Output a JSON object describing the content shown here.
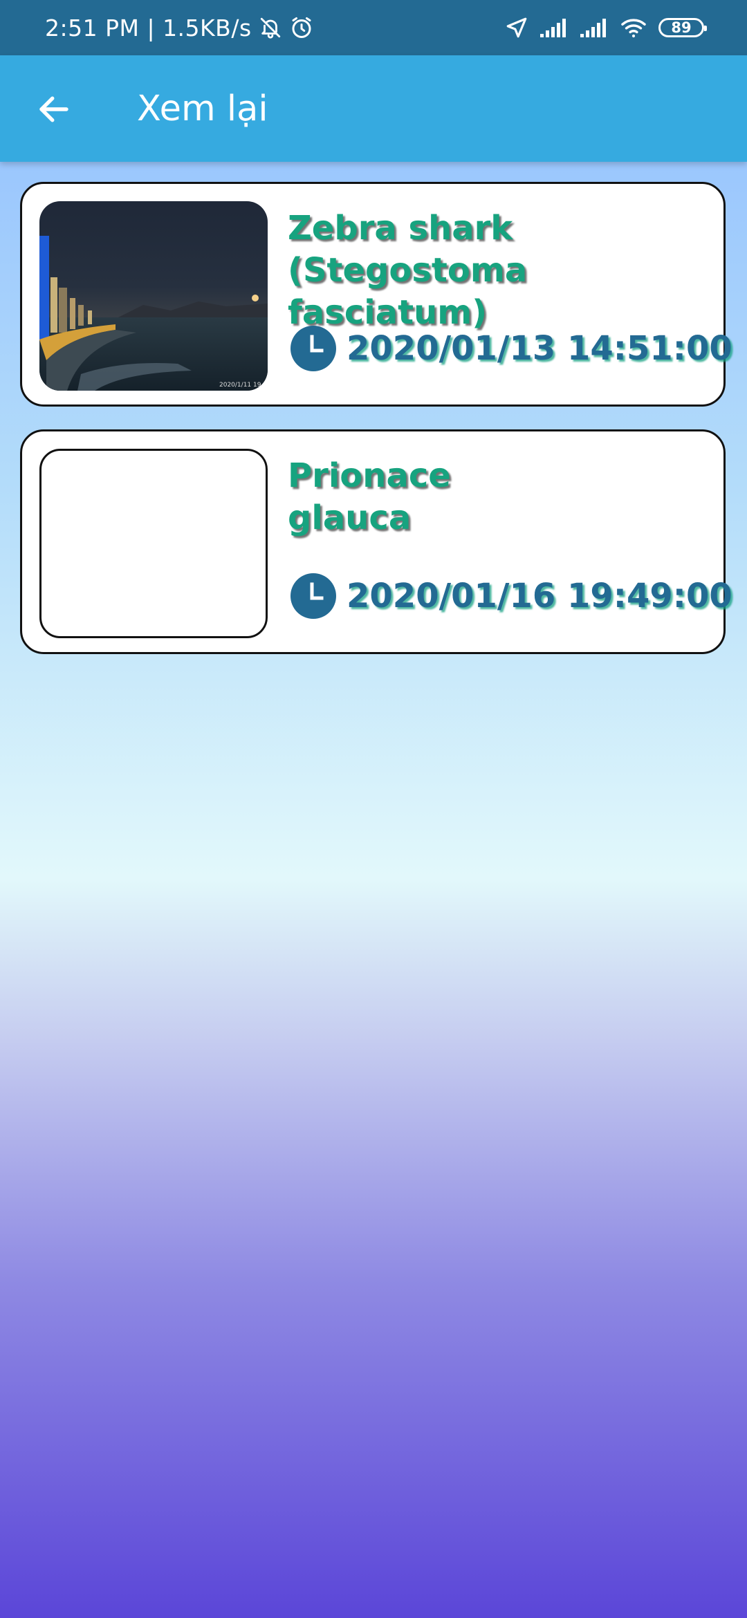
{
  "status_bar": {
    "time_speed": "2:51 PM | 1.5KB/s",
    "battery": "89",
    "icons": [
      "bell-off-icon",
      "alarm-icon",
      "location-icon",
      "signal-icon",
      "signal-icon",
      "wifi-icon",
      "battery-icon"
    ]
  },
  "app_bar": {
    "title": "Xem lại",
    "back_icon": "arrow-left-icon"
  },
  "records": [
    {
      "name": "Zebra shark (Stegostoma fasciatum)",
      "datetime": "2020/01/13 14:51:00",
      "has_photo": true
    },
    {
      "name": "Prionace glauca",
      "datetime": "2020/01/16 19:49:00",
      "has_photo": false
    }
  ],
  "colors": {
    "status_bar": "#236a93",
    "app_bar": "#36aae0",
    "name_text": "#17a37f",
    "time_text": "#236a93"
  }
}
